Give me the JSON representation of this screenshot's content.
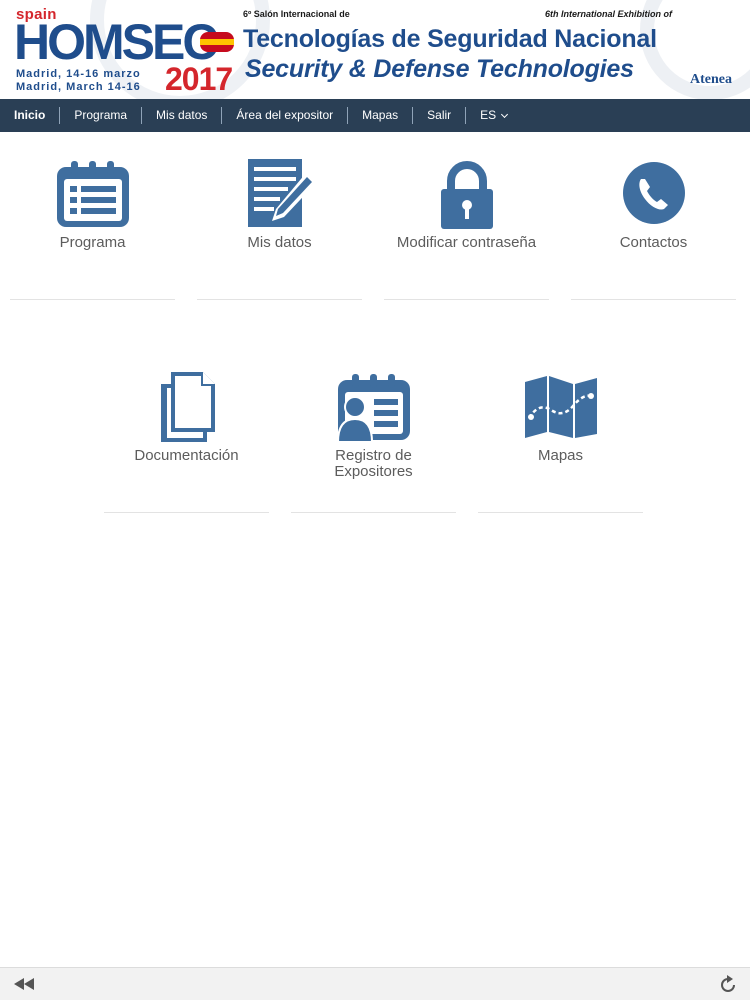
{
  "banner": {
    "logo_spain": "spain",
    "logo_name": "HOMSEC",
    "logo_dates_es": "Madrid, 14-16 marzo",
    "logo_dates_en": "Madrid, March 14-16",
    "logo_year": "2017",
    "subtitle_es": "6º Salón Internacional de",
    "subtitle_en": "6th International Exhibition of",
    "title_es": "Tecnologías de Seguridad Nacional",
    "title_en": "Security & Defense Technologies",
    "sponsor": "Atenea",
    "colors": {
      "brand_blue": "#1f4d8c",
      "brand_red": "#d4262c",
      "flag_red": "#c60b1e",
      "flag_yellow": "#ffc400"
    }
  },
  "nav": {
    "items": [
      {
        "label": "Inicio"
      },
      {
        "label": "Programa"
      },
      {
        "label": "Mis datos"
      },
      {
        "label": "Área del expositor"
      },
      {
        "label": "Mapas"
      },
      {
        "label": "Salir"
      }
    ],
    "language": "ES",
    "background": "#2a3f55"
  },
  "tiles": [
    {
      "label": "Programa",
      "icon": "calendar-list-icon"
    },
    {
      "label": "Mis datos",
      "icon": "document-edit-icon"
    },
    {
      "label": "Modificar contraseña",
      "icon": "lock-icon"
    },
    {
      "label": "Contactos",
      "icon": "phone-icon"
    },
    {
      "label": "Documentación",
      "icon": "documents-icon"
    },
    {
      "label": "Registro de Expositores",
      "icon": "exhibitor-register-icon"
    },
    {
      "label": "Mapas",
      "icon": "map-icon"
    }
  ],
  "icon_color": "#3f6e9f",
  "toolbar": {
    "back_icon": "rewind-icon",
    "reload_icon": "reload-icon"
  }
}
